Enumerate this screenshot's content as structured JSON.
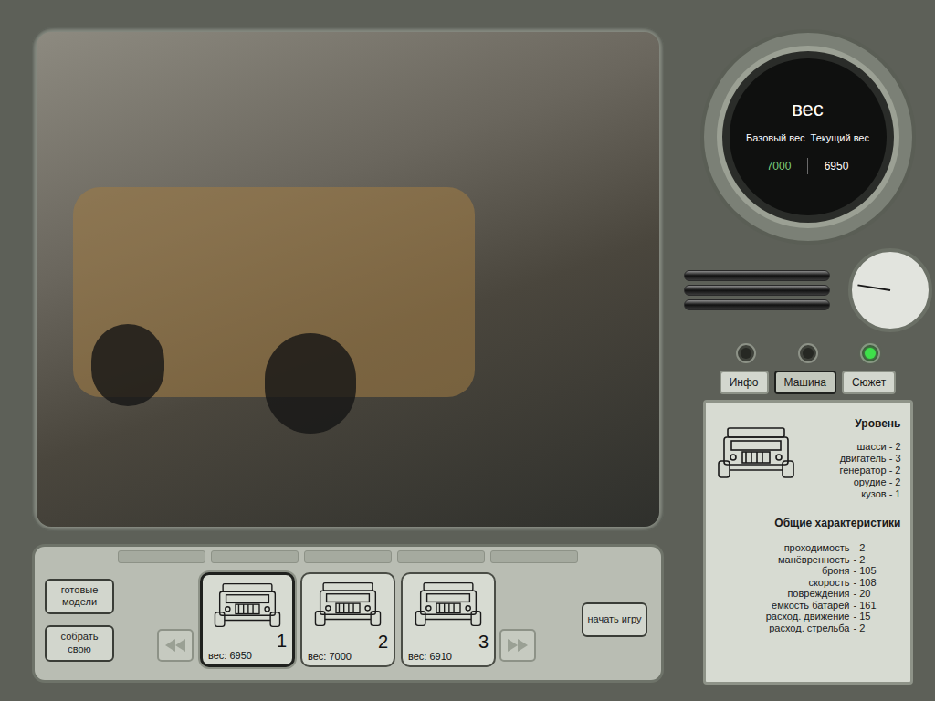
{
  "gauge": {
    "title": "вес",
    "base_label": "Базовый вес",
    "current_label": "Текущий вес",
    "base_value": "7000",
    "current_value": "6950"
  },
  "dial": {
    "level": 0.05
  },
  "lights": [
    {
      "on": false
    },
    {
      "on": false
    },
    {
      "on": true
    }
  ],
  "tabs": [
    {
      "label": "Инфо",
      "selected": false
    },
    {
      "label": "Машина",
      "selected": true
    },
    {
      "label": "Сюжет",
      "selected": false
    }
  ],
  "info": {
    "level_title": "Уровень",
    "levels": [
      "шасси - 2",
      "двигатель - 3",
      "генератор - 2",
      "орудие - 2",
      "кузов - 1"
    ],
    "stats_title": "Общие характеристики",
    "stats": [
      {
        "label": "проходимость",
        "value": "- 2"
      },
      {
        "label": "манёвренность",
        "value": "- 2"
      },
      {
        "label": "броня",
        "value": "- 105"
      },
      {
        "label": "скорость",
        "value": "- 108"
      },
      {
        "label": "повреждения",
        "value": "- 20"
      },
      {
        "label": "ёмкость батарей",
        "value": "- 161"
      },
      {
        "label": "расход. движение",
        "value": "- 15"
      },
      {
        "label": "расход. стрельба",
        "value": "- 2"
      }
    ]
  },
  "buttons": {
    "ready_models": "готовые модели",
    "build_own": "собрать свою",
    "start": "начать игру"
  },
  "models": [
    {
      "number": "1",
      "weight": "вес: 6950",
      "selected": true
    },
    {
      "number": "2",
      "weight": "вес: 7000",
      "selected": false
    },
    {
      "number": "3",
      "weight": "вес: 6910",
      "selected": false
    }
  ]
}
